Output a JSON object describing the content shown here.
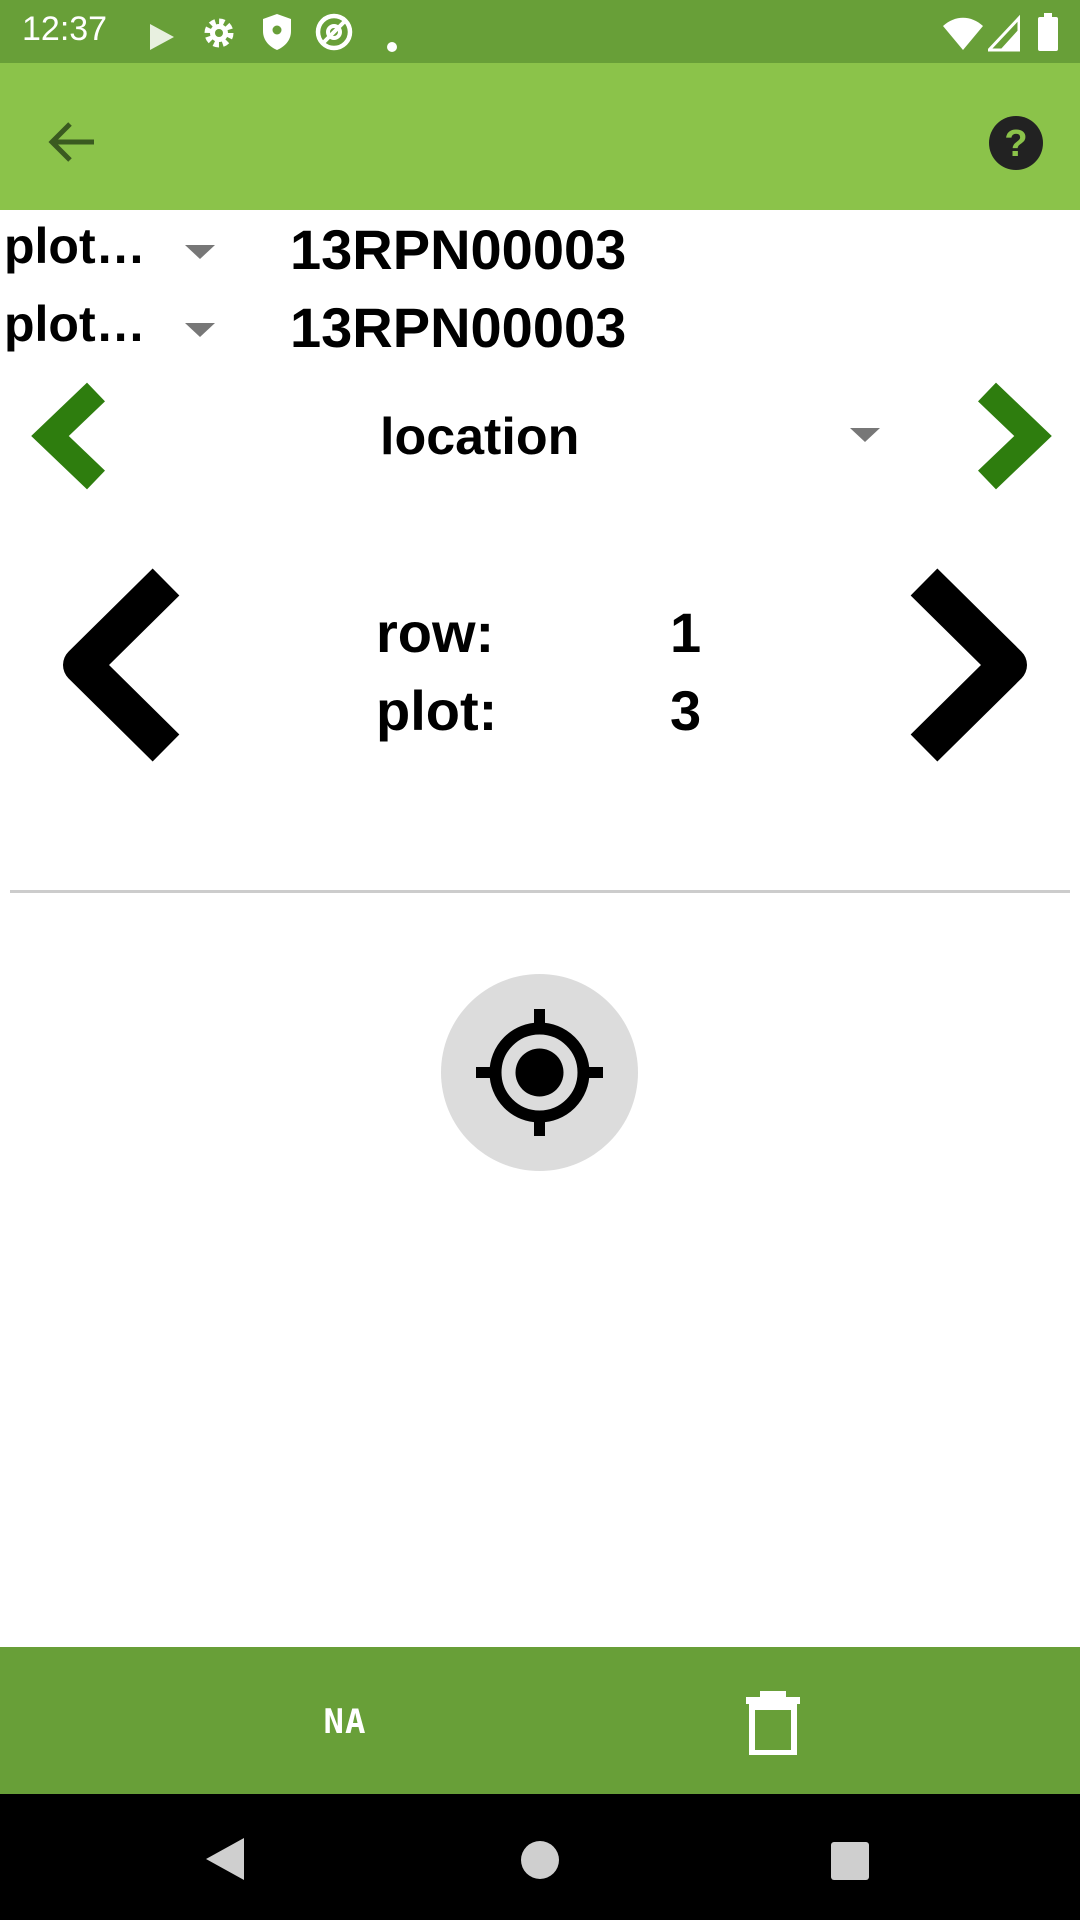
{
  "status_bar": {
    "time": "12:37",
    "icons": [
      "play-icon",
      "settings-icon",
      "shield-icon",
      "at-sign-icon",
      "dot-icon",
      "wifi-icon",
      "signal-icon",
      "battery-icon"
    ]
  },
  "app_bar": {
    "back_icon": "arrow-left-icon",
    "help_icon": "help-circle-icon"
  },
  "selectors": [
    {
      "label": "plot…",
      "value": "13RPN00003"
    },
    {
      "label": "plot…",
      "value": "13RPN00003"
    }
  ],
  "trait": {
    "name": "location"
  },
  "plot_info": {
    "row_label": "row:",
    "row_value": "1",
    "plot_label": "plot:",
    "plot_value": "3"
  },
  "actions": {
    "na_label": "NA",
    "gps_icon": "gps-target-icon",
    "delete_icon": "trash-icon"
  },
  "colors": {
    "status_bar": "#689f38",
    "app_bar": "#8bc34a",
    "bottom_bar": "#689f38",
    "trait_arrow": "#2e7d0e",
    "gps_button_bg": "#dcdcdc"
  }
}
